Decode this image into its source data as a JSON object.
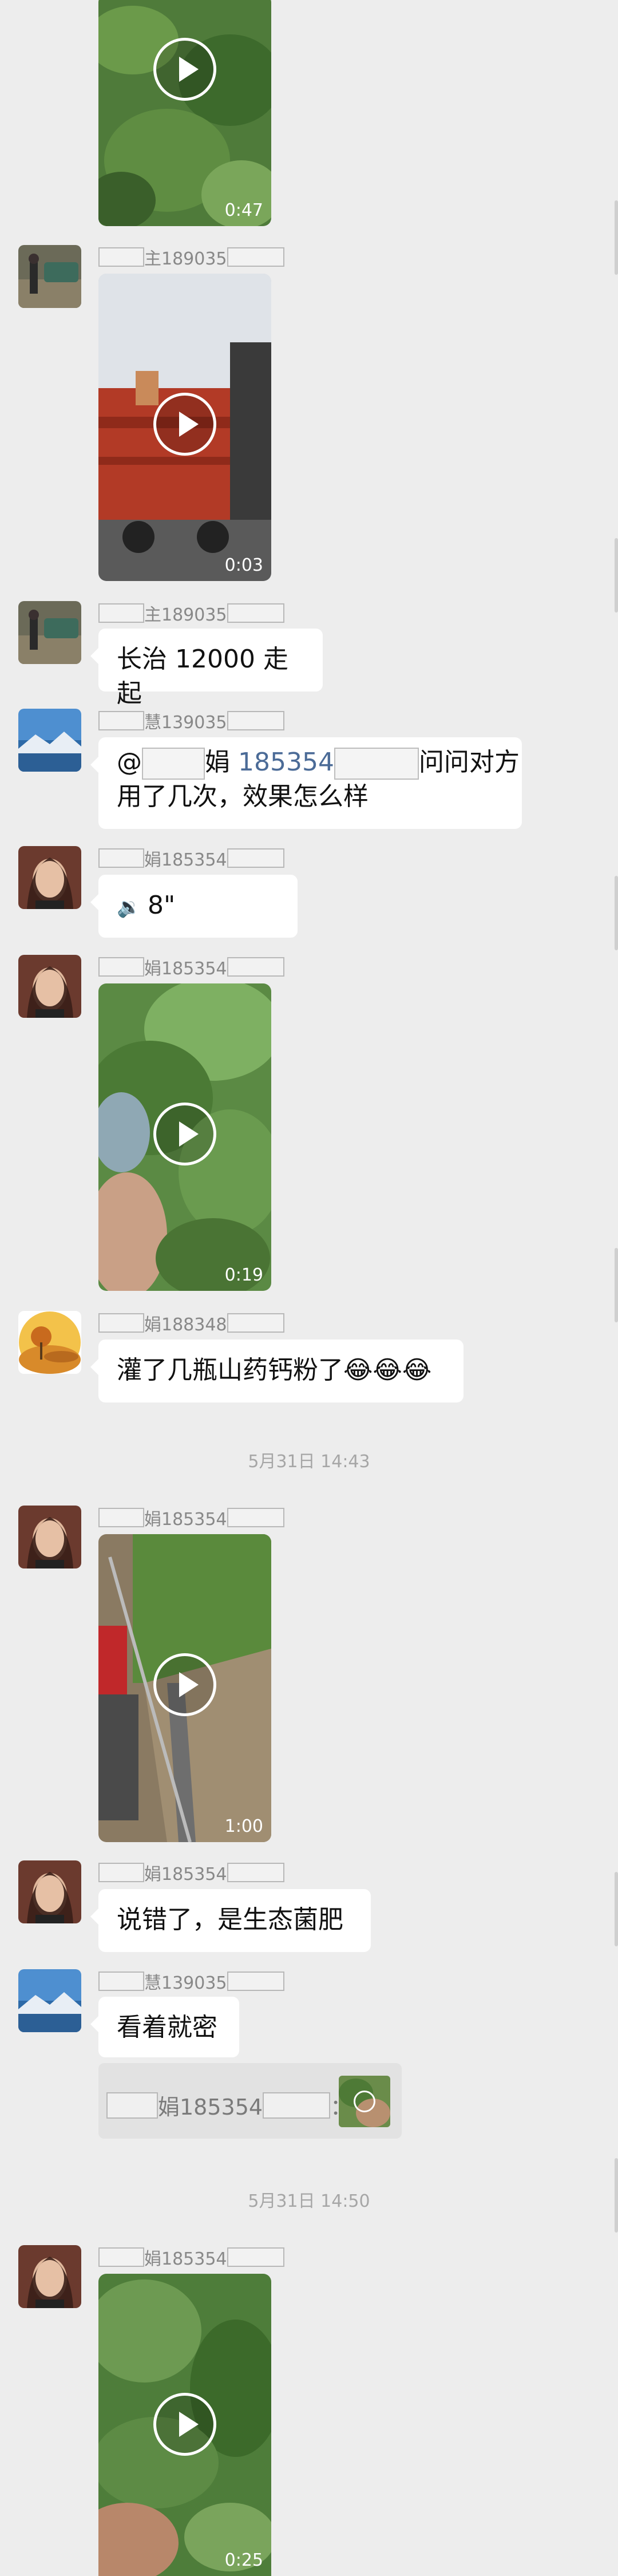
{
  "messages": {
    "m1": {
      "duration": "0:47"
    },
    "m2": {
      "name_suffix": "主189035",
      "duration": "0:03"
    },
    "m3": {
      "name_suffix": "主189035",
      "text": "长治 12000 走起"
    },
    "m4": {
      "name_suffix": "慧139035",
      "mention_at": "@",
      "mention_char": "娟",
      "mention_number": "185354",
      "text_tail": "问问对方",
      "text_line2": "用了几次，效果怎么样"
    },
    "m5": {
      "name_suffix": "娟185354",
      "voice_duration": "8\""
    },
    "m6": {
      "name_suffix": "娟185354",
      "duration": "0:19"
    },
    "m7": {
      "name_suffix": "娟188348",
      "text": "灌了几瓶山药钙粉了😂😂😂"
    },
    "time1": "5月31日 14:43",
    "m8": {
      "name_suffix": "娟185354",
      "duration": "1:00"
    },
    "m9": {
      "name_suffix": "娟185354",
      "text": "说错了，是生态菌肥"
    },
    "m10": {
      "name_suffix": "慧139035",
      "text": "看着就密",
      "quote_name": "娟185354",
      "quote_sep": "："
    },
    "time2": "5月31日 14:50",
    "m11": {
      "name_suffix": "娟185354",
      "duration": "0:25"
    }
  }
}
